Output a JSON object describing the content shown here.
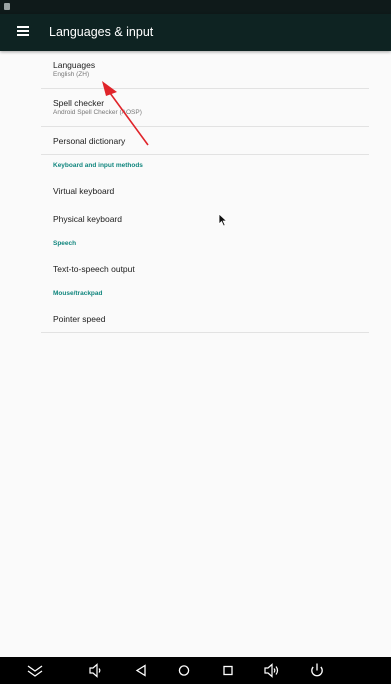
{
  "toolbar": {
    "title": "Languages & input"
  },
  "items": {
    "languages": {
      "title": "Languages",
      "summary": "English (ZH)"
    },
    "spell_checker": {
      "title": "Spell checker",
      "summary": "Android Spell Checker (AOSP)"
    },
    "personal_dictionary": {
      "title": "Personal dictionary"
    },
    "virtual_keyboard": {
      "title": "Virtual keyboard"
    },
    "physical_keyboard": {
      "title": "Physical keyboard"
    },
    "tts_output": {
      "title": "Text-to-speech output"
    },
    "pointer_speed": {
      "title": "Pointer speed"
    }
  },
  "categories": {
    "keyboard": "Keyboard and input methods",
    "speech": "Speech",
    "mouse": "Mouse/trackpad"
  },
  "colors": {
    "toolbar_bg": "#0e2322",
    "accent": "#11867e",
    "annotation_arrow": "#e0242a"
  },
  "navbar": {
    "icons": [
      "chevron-down-icon",
      "volume-down-icon",
      "back-icon",
      "home-icon",
      "recents-icon",
      "volume-up-icon",
      "power-icon"
    ]
  }
}
